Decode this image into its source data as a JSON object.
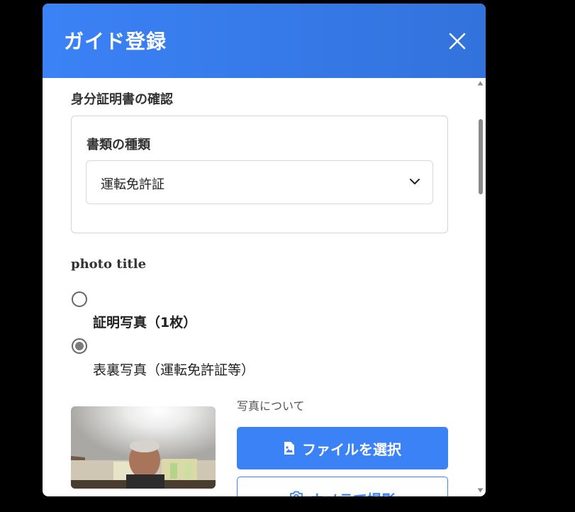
{
  "modal": {
    "title": "ガイド登録",
    "close_icon": "close-icon"
  },
  "id_section": {
    "title": "身分証明書の確認",
    "doc_type_label": "書類の種類",
    "doc_type_value": "運転免許証"
  },
  "photo_section": {
    "title": "photo title",
    "options": [
      {
        "label": "証明写真（1枚）",
        "checked": false
      },
      {
        "label": "表裏写真（運転免許証等）",
        "checked": true
      }
    ],
    "about_label": "写真について",
    "file_button_label": "ファイルを選択",
    "camera_button_label": "カメラで撮影"
  },
  "colors": {
    "accent": "#3b82f6",
    "header_gradient_end": "#3272dc"
  }
}
